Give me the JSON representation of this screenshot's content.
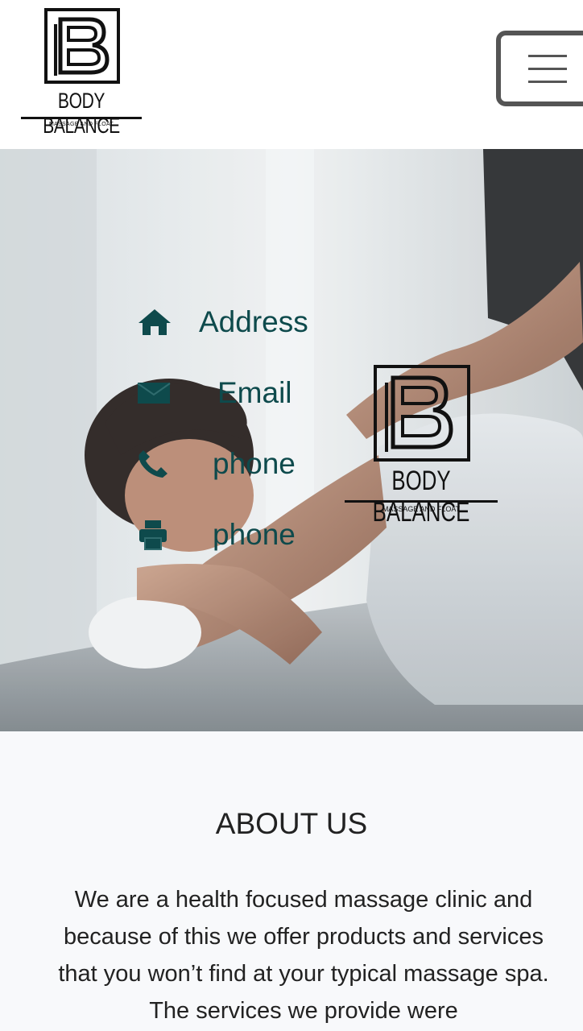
{
  "brand": {
    "name": "BODY BALANCE",
    "tagline": "MASSAGE AND FLOAT",
    "ink": "#111111"
  },
  "hero": {
    "contact": [
      {
        "icon": "home-icon",
        "label": "Address"
      },
      {
        "icon": "envelope-icon",
        "label": "Email"
      },
      {
        "icon": "phone-icon",
        "label": "phone"
      },
      {
        "icon": "printer-icon",
        "label": "phone"
      }
    ],
    "accent": "#0e4a4c"
  },
  "about": {
    "title": "ABOUT US",
    "text": "We are a health focused massage clinic and because of this we offer products and services that you won’t find at your typical massage spa. The services we provide were"
  }
}
